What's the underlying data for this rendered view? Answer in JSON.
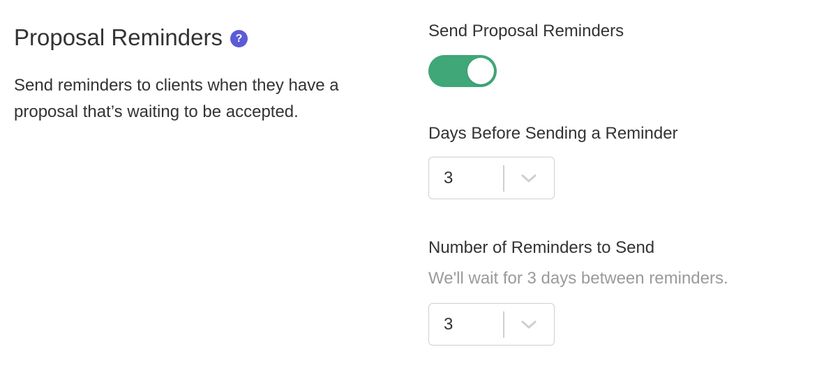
{
  "section": {
    "title": "Proposal Reminders",
    "help_icon": "question-circle-icon",
    "help_glyph": "?",
    "description": "Send reminders to clients when they have a proposal that’s waiting to be accepted."
  },
  "send_reminders": {
    "label": "Send Proposal Reminders",
    "enabled": true
  },
  "days_before": {
    "label": "Days Before Sending a Reminder",
    "selected": "3",
    "caret_icon": "chevron-down-icon"
  },
  "reminder_count": {
    "label": "Number of Reminders to Send",
    "hint": "We'll wait for 3 days between reminders.",
    "selected": "3",
    "caret_icon": "chevron-down-icon"
  },
  "colors": {
    "toggle_on": "#3fa778",
    "help_icon_bg": "#5b5bd6",
    "hint_text": "#9a9a9a",
    "border": "#cfcfcf"
  }
}
